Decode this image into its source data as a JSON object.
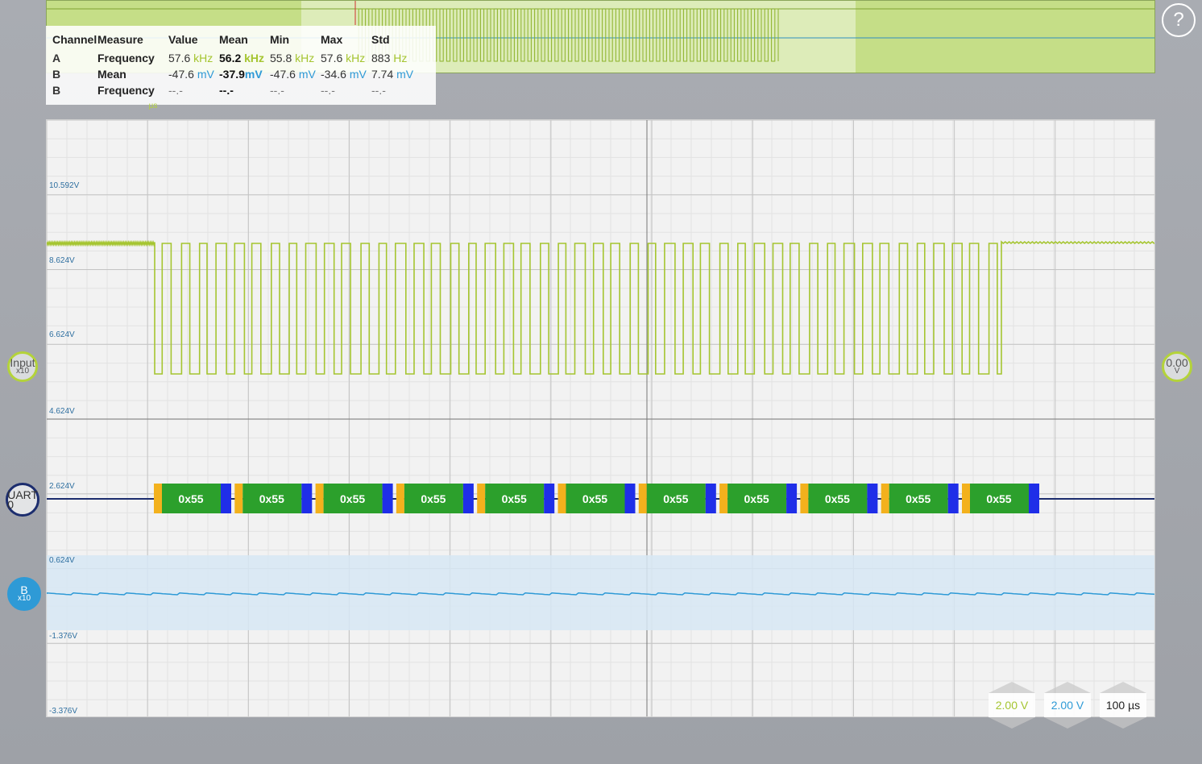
{
  "help_label": "?",
  "measurements": {
    "headers": [
      "Channel",
      "Measure",
      "Value",
      "Mean",
      "Min",
      "Max",
      "Std"
    ],
    "rows": [
      {
        "channel": "A",
        "measure": "Frequency",
        "value": "57.6",
        "value_unit": "kHz",
        "mean": "56.2",
        "mean_unit": "kHz",
        "min": "55.8",
        "min_unit": "kHz",
        "max": "57.6",
        "max_unit": "kHz",
        "std": "883",
        "std_unit": "Hz"
      },
      {
        "channel": "B",
        "measure": "Mean",
        "value": "-47.6",
        "value_unit": "mV",
        "mean": "-37.9",
        "mean_unit": "mV",
        "min": "-47.6",
        "min_unit": "mV",
        "max": "-34.6",
        "max_unit": "mV",
        "std": "7.74",
        "std_unit": "mV"
      },
      {
        "channel": "B",
        "measure": "Frequency",
        "value": "--.-",
        "value_unit": "",
        "mean": "--.-",
        "mean_unit": "",
        "min": "--.-",
        "min_unit": "",
        "max": "--.-",
        "max_unit": "",
        "std": "--.-",
        "std_unit": ""
      }
    ]
  },
  "voltage_labels": [
    "10.592V",
    "8.624V",
    "6.624V",
    "4.624V",
    "2.624V",
    "0.624V",
    "-1.376V",
    "-3.376V"
  ],
  "channels": {
    "input": {
      "label": "Input",
      "scale": "x10"
    },
    "uart": {
      "label": "UART 0"
    },
    "b": {
      "label": "B",
      "scale": "x10"
    },
    "offset": {
      "label": "0.00",
      "unit": "V"
    }
  },
  "uart_frames": [
    "0x55",
    "0x55",
    "0x55",
    "0x55",
    "0x55",
    "0x55",
    "0x55",
    "0x55",
    "0x55",
    "0x55",
    "0x55"
  ],
  "controls": {
    "ch_a_scale": "2.00 V",
    "ch_b_scale": "2.00 V",
    "timebase": "100 µs"
  },
  "trigger_label": "µs",
  "colors": {
    "ch_a": "#a5c530",
    "ch_b": "#2e9ad6",
    "uart": "#1c2d6e",
    "frame_data": "#2ca02c",
    "frame_start": "#f3b11d",
    "frame_stop": "#1f2ee8"
  }
}
